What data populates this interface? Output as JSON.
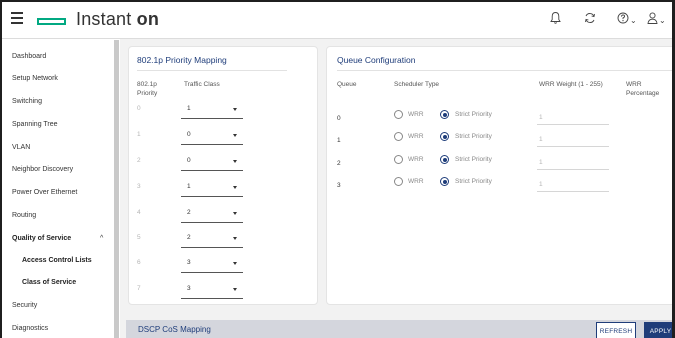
{
  "app": {
    "brand_text": "Instant ",
    "brand_bold": "on"
  },
  "header": {
    "bell_icon": "bell-icon",
    "refresh_icon": "sync-icon",
    "help_icon": "help-icon",
    "user_icon": "user-icon"
  },
  "sidebar": {
    "items": [
      {
        "label": "Dashboard"
      },
      {
        "label": "Setup Network"
      },
      {
        "label": "Switching"
      },
      {
        "label": "Spanning Tree"
      },
      {
        "label": "VLAN"
      },
      {
        "label": "Neighbor Discovery"
      },
      {
        "label": "Power Over Ethernet"
      },
      {
        "label": "Routing"
      },
      {
        "label": "Quality of Service",
        "expanded_caret": "^"
      },
      {
        "label": "Access Control Lists"
      },
      {
        "label": "Class of Service"
      },
      {
        "label": "Security"
      },
      {
        "label": "Diagnostics"
      }
    ]
  },
  "priority_panel": {
    "title": "802.1p Priority Mapping",
    "col_priority": "802.1p Priority",
    "col_priority_l1": "802.1p",
    "col_priority_l2": "Priority",
    "col_traffic": "Traffic Class",
    "rows": [
      {
        "priority": "0",
        "class": "1"
      },
      {
        "priority": "1",
        "class": "0"
      },
      {
        "priority": "2",
        "class": "0"
      },
      {
        "priority": "3",
        "class": "1"
      },
      {
        "priority": "4",
        "class": "2"
      },
      {
        "priority": "5",
        "class": "2"
      },
      {
        "priority": "6",
        "class": "3"
      },
      {
        "priority": "7",
        "class": "3"
      }
    ]
  },
  "queue_panel": {
    "title": "Queue Configuration",
    "col_queue": "Queue",
    "col_scheduler": "Scheduler Type",
    "col_weight": "WRR Weight (1 - 255)",
    "col_pct_l1": "WRR",
    "col_pct_l2": "Percentage",
    "wrr_label": "WRR",
    "strict_label": "Strict Priority",
    "rows": [
      {
        "queue": "0",
        "weight": "1"
      },
      {
        "queue": "1",
        "weight": "1"
      },
      {
        "queue": "2",
        "weight": "1"
      },
      {
        "queue": "3",
        "weight": "1"
      }
    ]
  },
  "footer": {
    "section_title": "DSCP CoS Mapping",
    "refresh_label": "REFRESH",
    "apply_label": "APPLY"
  },
  "colors": {
    "brand_green": "#01a982",
    "accent_blue": "#1f3d7a"
  }
}
